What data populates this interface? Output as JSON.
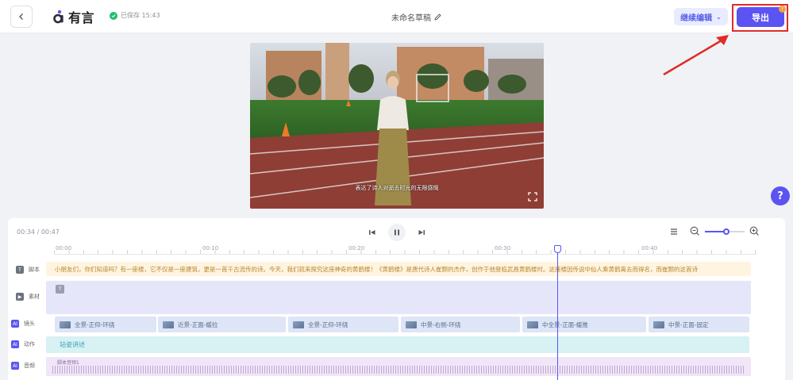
{
  "header": {
    "logo_text": "有言",
    "saved_text": "已保存 15:43",
    "draft_title": "未命名草稿",
    "continue_label": "继续编辑",
    "export_label": "导出"
  },
  "preview": {
    "subtitle": "表达了诗人对逝去时光的无限感慨"
  },
  "help": {
    "label": "?"
  },
  "timeline": {
    "time_display": "00:34 / 00:47",
    "ruler": [
      "00:00",
      "00:10",
      "00:20",
      "00:30",
      "00:40"
    ],
    "rows": {
      "script": "脚本",
      "material": "素材",
      "camera": "镜头",
      "action": "动作",
      "audio": "音频"
    },
    "script_text": "小朋友们，你们知道吗？有一座楼，它不仅是一座建筑，更是一首千古流传的诗。今天，我们就来探究这座神奇的黄鹤楼！《黄鹤楼》是唐代诗人崔颢的杰作，创作于他登临武昌黄鹤楼时。这座楼因传说中仙人乘黄鹤离去而得名，而崔颢的这首诗",
    "shots": [
      "全景-正仰-环绕",
      "近景-正面-缓拉",
      "全景-正仰-环绕",
      "中景-右侧-环绕",
      "中全景-正面-缓推",
      "中景-正面-固定"
    ],
    "action_text": "站姿讲述",
    "audio_label": "脚本音频1"
  }
}
